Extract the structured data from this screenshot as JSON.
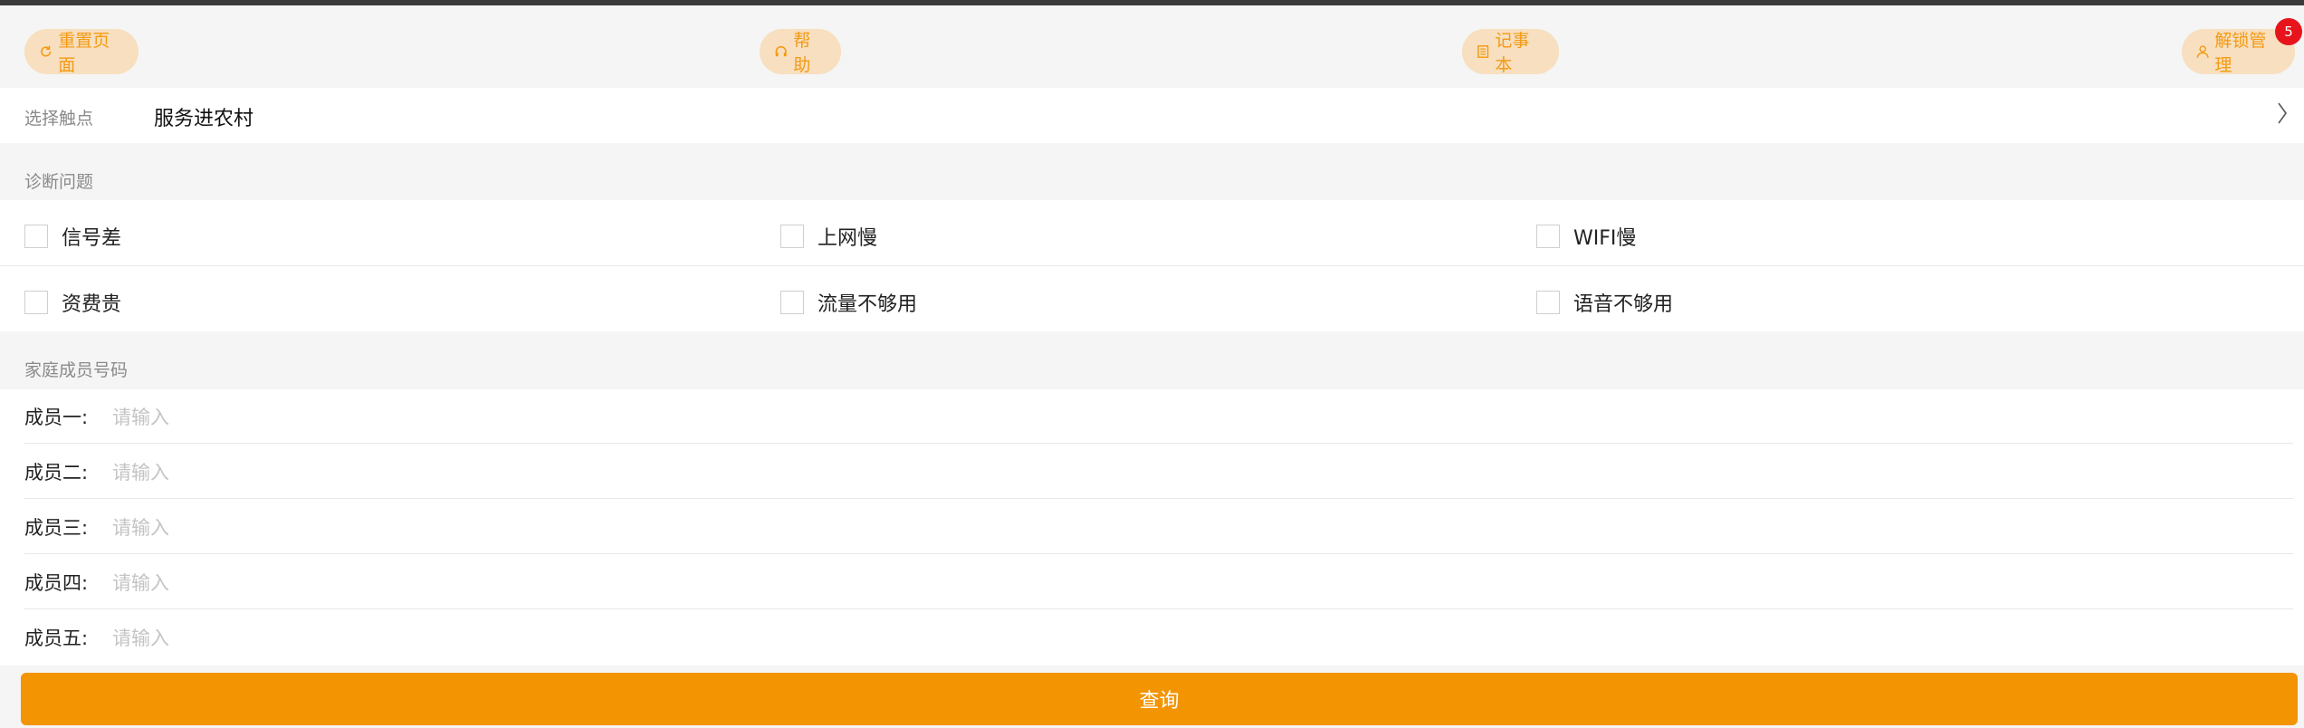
{
  "toolbar": {
    "reset_label": "重置页面",
    "help_label": "帮助",
    "notepad_label": "记事本",
    "unlock_label": "解锁管理",
    "unlock_badge": "5"
  },
  "touchpoint": {
    "label": "选择触点",
    "value": "服务进农村"
  },
  "diagnosis": {
    "title": "诊断问题",
    "options": [
      "信号差",
      "上网慢",
      "WIFI慢",
      "资费贵",
      "流量不够用",
      "语音不够用"
    ]
  },
  "family": {
    "title": "家庭成员号码",
    "members": [
      {
        "label": "成员一:",
        "placeholder": "请输入"
      },
      {
        "label": "成员二:",
        "placeholder": "请输入"
      },
      {
        "label": "成员三:",
        "placeholder": "请输入"
      },
      {
        "label": "成员四:",
        "placeholder": "请输入"
      },
      {
        "label": "成员五:",
        "placeholder": "请输入"
      }
    ]
  },
  "submit_label": "查询",
  "colors": {
    "accent": "#f39402",
    "pill_bg": "#f7dfbf",
    "badge": "#e8141b"
  }
}
